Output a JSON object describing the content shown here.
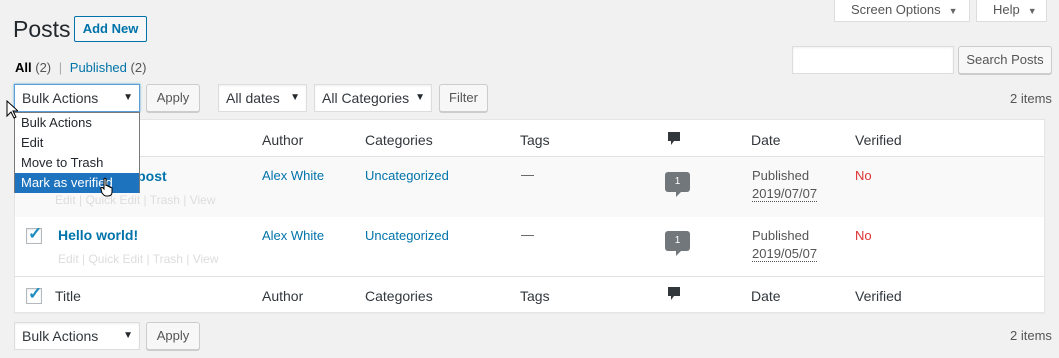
{
  "header": {
    "screen_options": "Screen Options",
    "help": "Help",
    "title": "Posts",
    "add_new": "Add New"
  },
  "filters": {
    "all_label": "All",
    "all_count": "(2)",
    "sep": "|",
    "published_label": "Published",
    "published_count": "(2)"
  },
  "search": {
    "value": "",
    "button": "Search Posts"
  },
  "tablenav_top": {
    "bulk_actions": "Bulk Actions",
    "apply": "Apply",
    "dates": "All dates",
    "categories": "All Categories",
    "filter": "Filter",
    "items": "2 items"
  },
  "bulk_dropdown": {
    "options": [
      "Bulk Actions",
      "Edit",
      "Move to Trash",
      "Mark as verified"
    ],
    "selected_index": 3
  },
  "table": {
    "columns": {
      "title": "Title",
      "author": "Author",
      "categories": "Categories",
      "tags": "Tags",
      "date": "Date",
      "verified": "Verified"
    },
    "rows": [
      {
        "title": "er post",
        "actions": "Edit | Quick Edit | Trash | View",
        "author": "Alex White",
        "category": "Uncategorized",
        "tags": "—",
        "comments": "1",
        "status": "Published",
        "date": "2019/07/07",
        "verified": "No",
        "checked": false
      },
      {
        "title": "Hello world!",
        "actions": "Edit | Quick Edit | Trash | View",
        "author": "Alex White",
        "category": "Uncategorized",
        "tags": "—",
        "comments": "1",
        "status": "Published",
        "date": "2019/05/07",
        "verified": "No",
        "checked": true
      }
    ]
  },
  "tablenav_bottom": {
    "bulk_actions": "Bulk Actions",
    "apply": "Apply",
    "items": "2 items"
  },
  "colors": {
    "link": "#0073aa",
    "no": "#dc3232",
    "highlight": "#1e73be"
  }
}
